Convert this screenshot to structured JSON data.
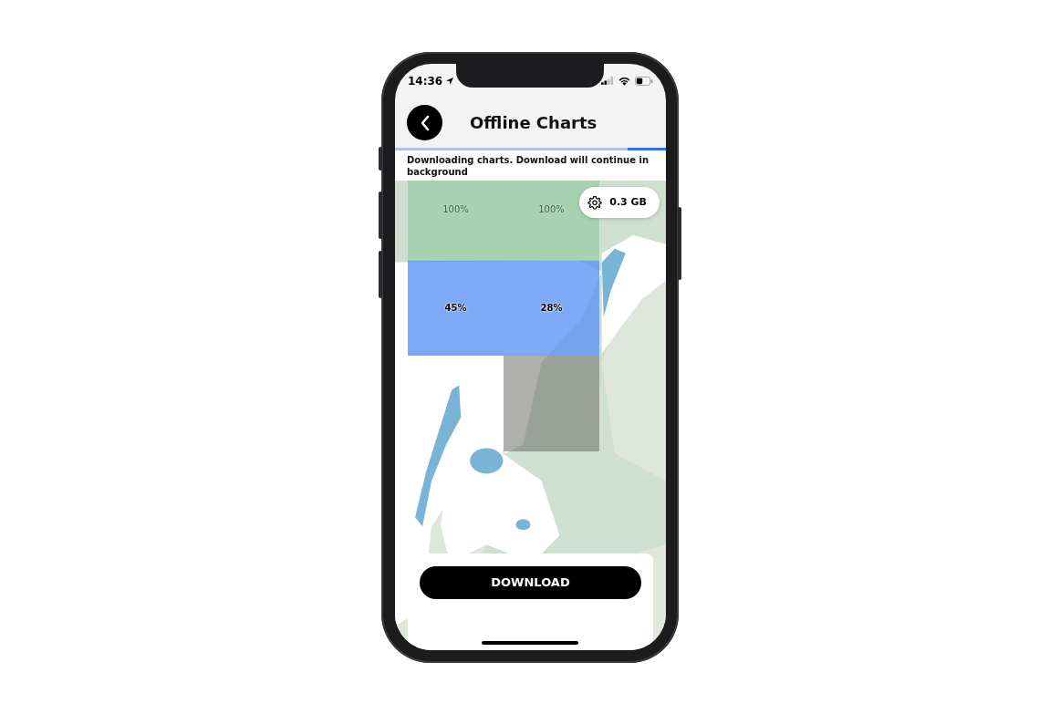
{
  "status_bar": {
    "time": "14:36"
  },
  "header": {
    "title": "Offline Charts"
  },
  "progress": {
    "level": 0.86
  },
  "notice": "Downloading charts. Download will continue in background",
  "storage": {
    "label": "0.3 GB"
  },
  "tiles": [
    [
      {
        "kind": "complete",
        "label": "100%"
      },
      {
        "kind": "complete",
        "label": "100%"
      }
    ],
    [
      {
        "kind": "downloading",
        "label": "45%"
      },
      {
        "kind": "downloading",
        "label": "28%"
      }
    ],
    [
      {
        "kind": "empty"
      },
      {
        "kind": "pending"
      }
    ]
  ],
  "actions": {
    "download": "DOWNLOAD"
  }
}
